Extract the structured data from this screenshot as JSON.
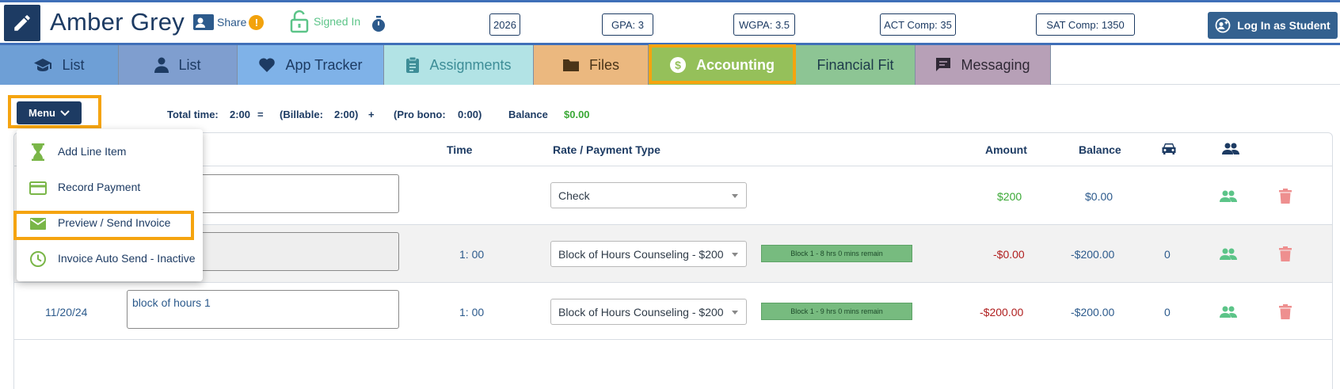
{
  "header": {
    "student_name": "Amber Grey",
    "share_label": "Share",
    "share_alert": "!",
    "signed_in_label": "Signed In",
    "stats": {
      "year": "2026",
      "gpa": "GPA: 3",
      "wgpa": "WGPA: 3.5",
      "act": "ACT Comp: 35",
      "sat": "SAT  Comp: 1350"
    },
    "login_label": "Log In as Student"
  },
  "tabs": [
    {
      "label": "List",
      "icon": "graduation-cap-icon",
      "bg": "#6e9fd6",
      "color": "#1d3b63"
    },
    {
      "label": "List",
      "icon": "person-icon",
      "bg": "#7f9ecf",
      "color": "#1d3b63"
    },
    {
      "label": "App Tracker",
      "icon": "heart-icon",
      "bg": "#7fb2e8",
      "color": "#1d3b63"
    },
    {
      "label": "Assignments",
      "icon": "clipboard-icon",
      "bg": "#b2e3e5",
      "color": "#3d8d97"
    },
    {
      "label": "Files",
      "icon": "folder-icon",
      "bg": "#ebb87f",
      "color": "#4a3418"
    },
    {
      "label": "Accounting",
      "icon": "dollar-circle-icon",
      "bg": "#95c05a",
      "color": "#ffffff"
    },
    {
      "label": "Financial Fit",
      "icon": "",
      "bg": "#8dc594",
      "color": "#1d3b4a"
    },
    {
      "label": "Messaging",
      "icon": "chat-icon",
      "bg": "#b7a0b7",
      "color": "#2f2835"
    }
  ],
  "summary": {
    "menu_label": "Menu",
    "total_time_label": "Total time:",
    "total_time_value": "2:00",
    "equals": "=",
    "billable_label": "(Billable:",
    "billable_value": "2:00)",
    "plus": "+",
    "pro_bono_label": "(Pro bono:",
    "pro_bono_value": "0:00)",
    "balance_label": "Balance",
    "balance_value": "$0.00"
  },
  "table": {
    "headers": {
      "time": "Time",
      "rate": "Rate / Payment Type",
      "amount": "Amount",
      "balance": "Balance"
    },
    "rows": [
      {
        "date": "",
        "description": "",
        "time": "",
        "rate": "Check",
        "badge": "",
        "amount": "$200",
        "balance": "$0.00",
        "count": ""
      },
      {
        "date": "",
        "description": "",
        "time": "1: 00",
        "rate": "Block of Hours Counseling - $200",
        "badge": "Block 1 - 8 hrs 0 mins remain",
        "amount": "-$0.00",
        "balance": "-$200.00",
        "count": "0"
      },
      {
        "date": "11/20/24",
        "description": "block of hours 1",
        "time": "1: 00",
        "rate": "Block of Hours Counseling - $200",
        "badge": "Block 1 - 9 hrs 0 mins remain",
        "amount": "-$200.00",
        "balance": "-$200.00",
        "count": "0"
      }
    ]
  },
  "menu_dropdown": {
    "items": [
      {
        "label": "Add Line Item",
        "icon": "hourglass-icon"
      },
      {
        "label": "Record Payment",
        "icon": "credit-card-icon"
      },
      {
        "label": "Preview / Send Invoice",
        "icon": "envelope-icon"
      },
      {
        "label": "Invoice Auto Send - Inactive",
        "icon": "clock-icon"
      }
    ]
  },
  "colors": {
    "navy": "#1d3b63",
    "highlight": "#f5a40f",
    "green": "#3aa835",
    "red": "#b02020"
  }
}
